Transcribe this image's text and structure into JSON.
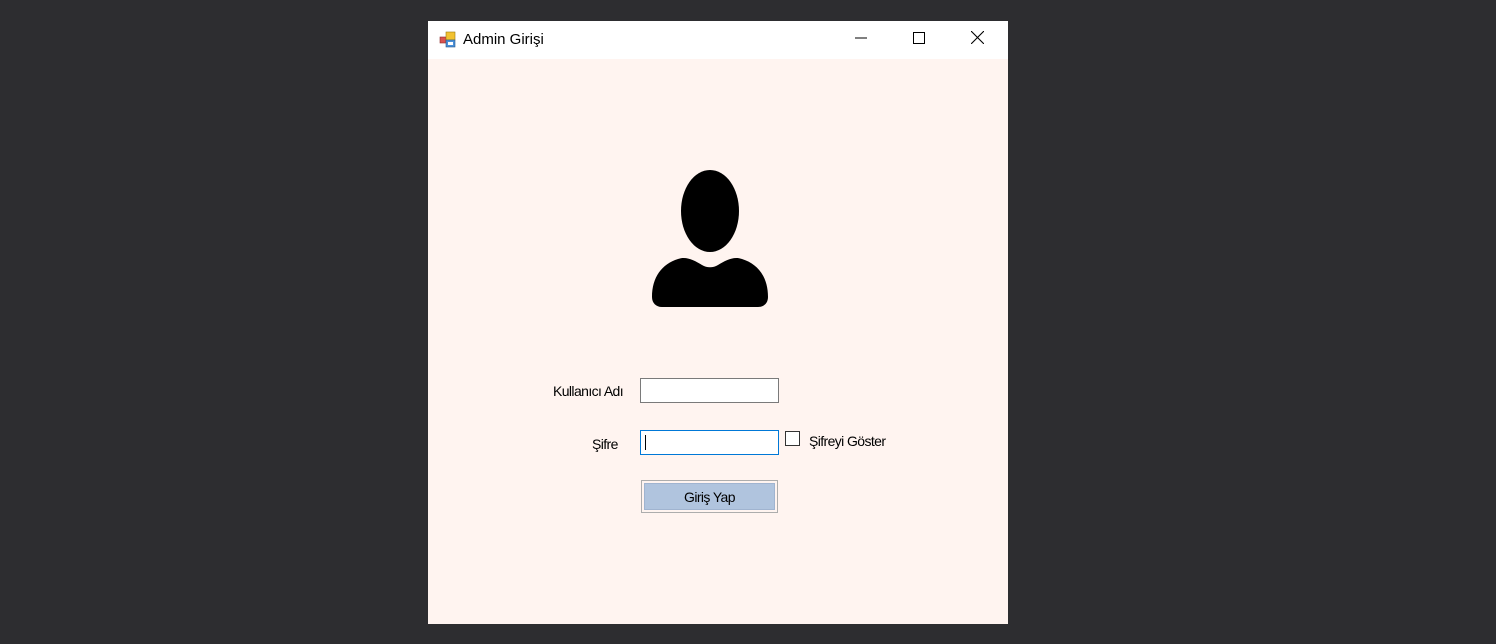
{
  "window": {
    "title": "Admin Girişi",
    "background": "#fff4f0",
    "titlebar_buttons": {
      "minimize_icon": "minimize-icon",
      "maximize_icon": "maximize-icon",
      "close_icon": "close-icon"
    }
  },
  "form": {
    "avatar_icon": "user-silhouette-icon",
    "username_label": "Kullanıcı Adı",
    "username_value": "",
    "password_label": "Şifre",
    "password_value": "",
    "show_password_label": "Şifreyi Göster",
    "show_password_checked": false,
    "login_button_label": "Giriş Yap",
    "login_button_color": "#b0c4de"
  }
}
